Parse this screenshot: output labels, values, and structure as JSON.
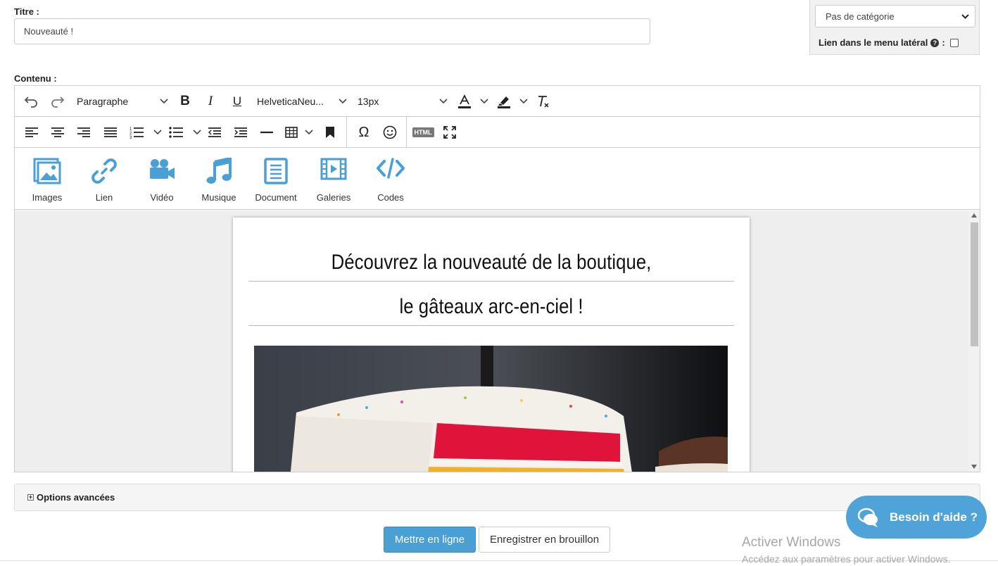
{
  "title_field": {
    "label": "Titre :",
    "value": "Nouveauté !"
  },
  "side_panel": {
    "category_value": "Pas de catégorie",
    "side_menu_label": "Lien dans le menu latéral",
    "side_menu_suffix": ":"
  },
  "content_label": "Contenu :",
  "toolbar": {
    "block_format": "Paragraphe",
    "font_family": "HelveticaNeu...",
    "font_size": "13px",
    "html_label": "HTML"
  },
  "media_bar": {
    "items": [
      {
        "label": "Images",
        "icon": "images-icon"
      },
      {
        "label": "Lien",
        "icon": "link-icon"
      },
      {
        "label": "Vidéo",
        "icon": "video-camera-icon"
      },
      {
        "label": "Musique",
        "icon": "music-note-icon"
      },
      {
        "label": "Document",
        "icon": "document-icon"
      },
      {
        "label": "Galeries",
        "icon": "gallery-film-icon"
      },
      {
        "label": "Codes",
        "icon": "code-icon"
      }
    ]
  },
  "document": {
    "heading_line1": "Découvrez la nouveauté de la boutique,",
    "heading_line2": "le gâteaux arc-en-ciel !"
  },
  "advanced_options_label": "Options avancées",
  "actions": {
    "publish_label": "Mettre en ligne",
    "draft_label": "Enregistrer en brouillon"
  },
  "help_widget": {
    "label": "Besoin d'aide ?"
  },
  "windows_watermark": {
    "line1": "Activer Windows",
    "line2": "Accédez aux paramètres pour activer Windows."
  },
  "colors": {
    "accent": "#4a9fd5",
    "icon_blue": "#4a9fd5",
    "editor_bg": "#eeeeee"
  }
}
